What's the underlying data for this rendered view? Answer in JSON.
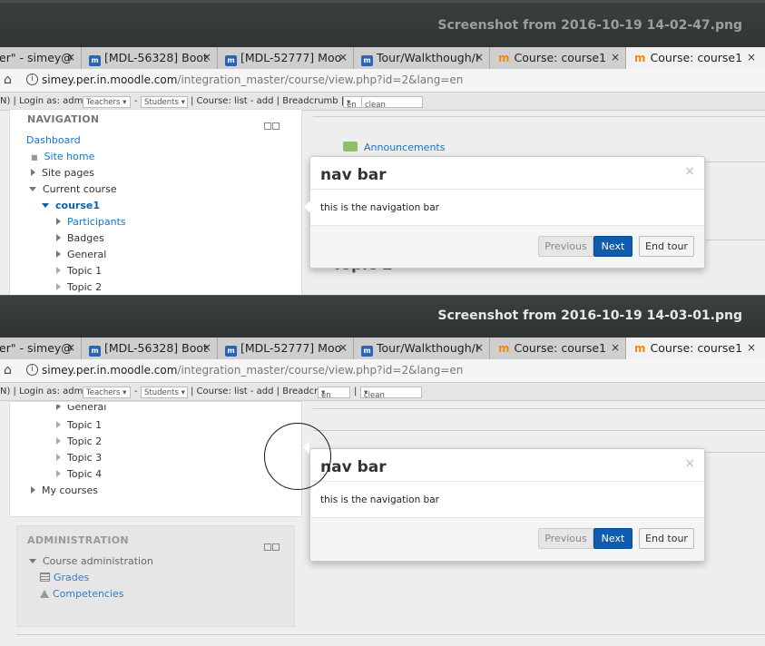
{
  "shot1": {
    "title": "Screenshot from 2016-10-19 14-02-47.png"
  },
  "shot2": {
    "title": "Screenshot from 2016-10-19 14-03-01.png"
  },
  "browser": {
    "tabs": [
      {
        "label": "er\" - simey@",
        "active": false
      },
      {
        "label": "[MDL-56328] Boot",
        "active": false
      },
      {
        "label": "[MDL-52777] Moo",
        "active": false
      },
      {
        "label": "Tour/Walkthough/I",
        "active": false
      },
      {
        "label": "Course: course1",
        "active": false
      },
      {
        "label": "Course: course1",
        "active": true
      }
    ],
    "tab_close": "×",
    "url_host": "simey.per.in.moodle.com",
    "url_path": "/integration_master/course/view.php?id=2&lang=en"
  },
  "toolbar": {
    "prefix": "N) | Login as: admin -",
    "teachers": "Teachers ▾",
    "dash": "-",
    "students": "Students ▾",
    "middle": "| Course: list - add | Breadcrumb |",
    "lang": "en",
    "pipe": "|",
    "theme": "clean"
  },
  "navigation": {
    "heading": "NAVIGATION",
    "dashboard": "Dashboard",
    "site_home": "Site home",
    "site_pages": "Site pages",
    "current_course": "Current course",
    "course": "course1",
    "participants": "Participants",
    "badges": "Badges",
    "general": "General",
    "topic1": "Topic 1",
    "topic2": "Topic 2",
    "topic3": "Topic 3",
    "topic4": "Topic 4",
    "my_courses": "My courses"
  },
  "administration": {
    "heading": "ADMINISTRATION",
    "course_admin": "Course administration",
    "grades": "Grades",
    "competencies": "Competencies"
  },
  "content": {
    "announcements": "Announcements",
    "topic2_heading": "Topic 2"
  },
  "popover": {
    "title": "nav bar",
    "close": "×",
    "body": "this is the navigation bar",
    "previous": "Previous",
    "next": "Next",
    "end_tour": "End tour"
  }
}
